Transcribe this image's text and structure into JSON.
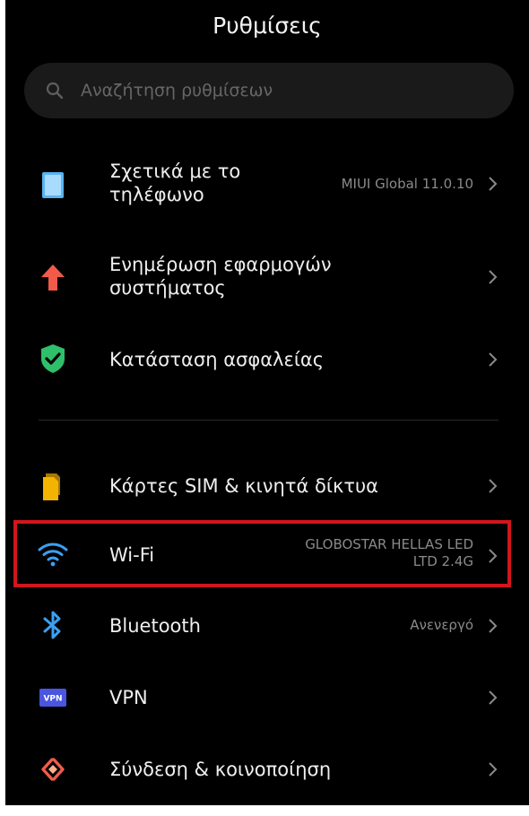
{
  "header": {
    "title": "Ρυθμίσεις"
  },
  "search": {
    "placeholder": "Αναζήτηση ρυθμίσεων",
    "icon": "search-icon"
  },
  "items": [
    {
      "name": "about-phone",
      "label": "Σχετικά με το τηλέφωνο",
      "label_line1": "Σχετικά με το",
      "label_line2": "τηλέφωνο",
      "value": "MIUI Global 11.0.10",
      "icon": "phone-info-icon",
      "icon_color": "#5ab4f0"
    },
    {
      "name": "system-update",
      "label": "Ενημέρωση εφαρμογών συστήματος",
      "label_line1": "Ενημέρωση εφαρμογών",
      "label_line2": "συστήματος",
      "value": "",
      "icon": "arrow-up-icon",
      "icon_color": "#f25a4a"
    },
    {
      "name": "security-status",
      "label": "Κατάσταση ασφαλείας",
      "value": "",
      "icon": "shield-check-icon",
      "icon_color": "#2fbf6a"
    },
    {
      "name": "sim-mobile-networks",
      "label": "Κάρτες SIM & κινητά δίκτυα",
      "value": "",
      "icon": "sim-card-icon",
      "icon_color": "#f2b400"
    },
    {
      "name": "wifi",
      "label": "Wi-Fi",
      "value_line1": "GLOBOSTAR HELLAS LED",
      "value_line2": "LTD 2.4G",
      "icon": "wifi-icon",
      "icon_color": "#3aa0f5",
      "highlighted": true
    },
    {
      "name": "bluetooth",
      "label": "Bluetooth",
      "value": "Ανενεργό",
      "icon": "bluetooth-icon",
      "icon_color": "#3aa0f5"
    },
    {
      "name": "vpn",
      "label": "VPN",
      "value": "",
      "icon": "vpn-icon",
      "icon_label": "VPN",
      "icon_color": "#4a56e0"
    },
    {
      "name": "connection-sharing",
      "label": "Σύνδεση & κοινοποίηση",
      "value": "",
      "icon": "connection-sharing-icon",
      "icon_color": "#f25a4a"
    }
  ],
  "colors": {
    "background": "#000000",
    "text": "#eeeeee",
    "secondary_text": "#8a8a8a",
    "highlight_border": "#d1161c"
  }
}
